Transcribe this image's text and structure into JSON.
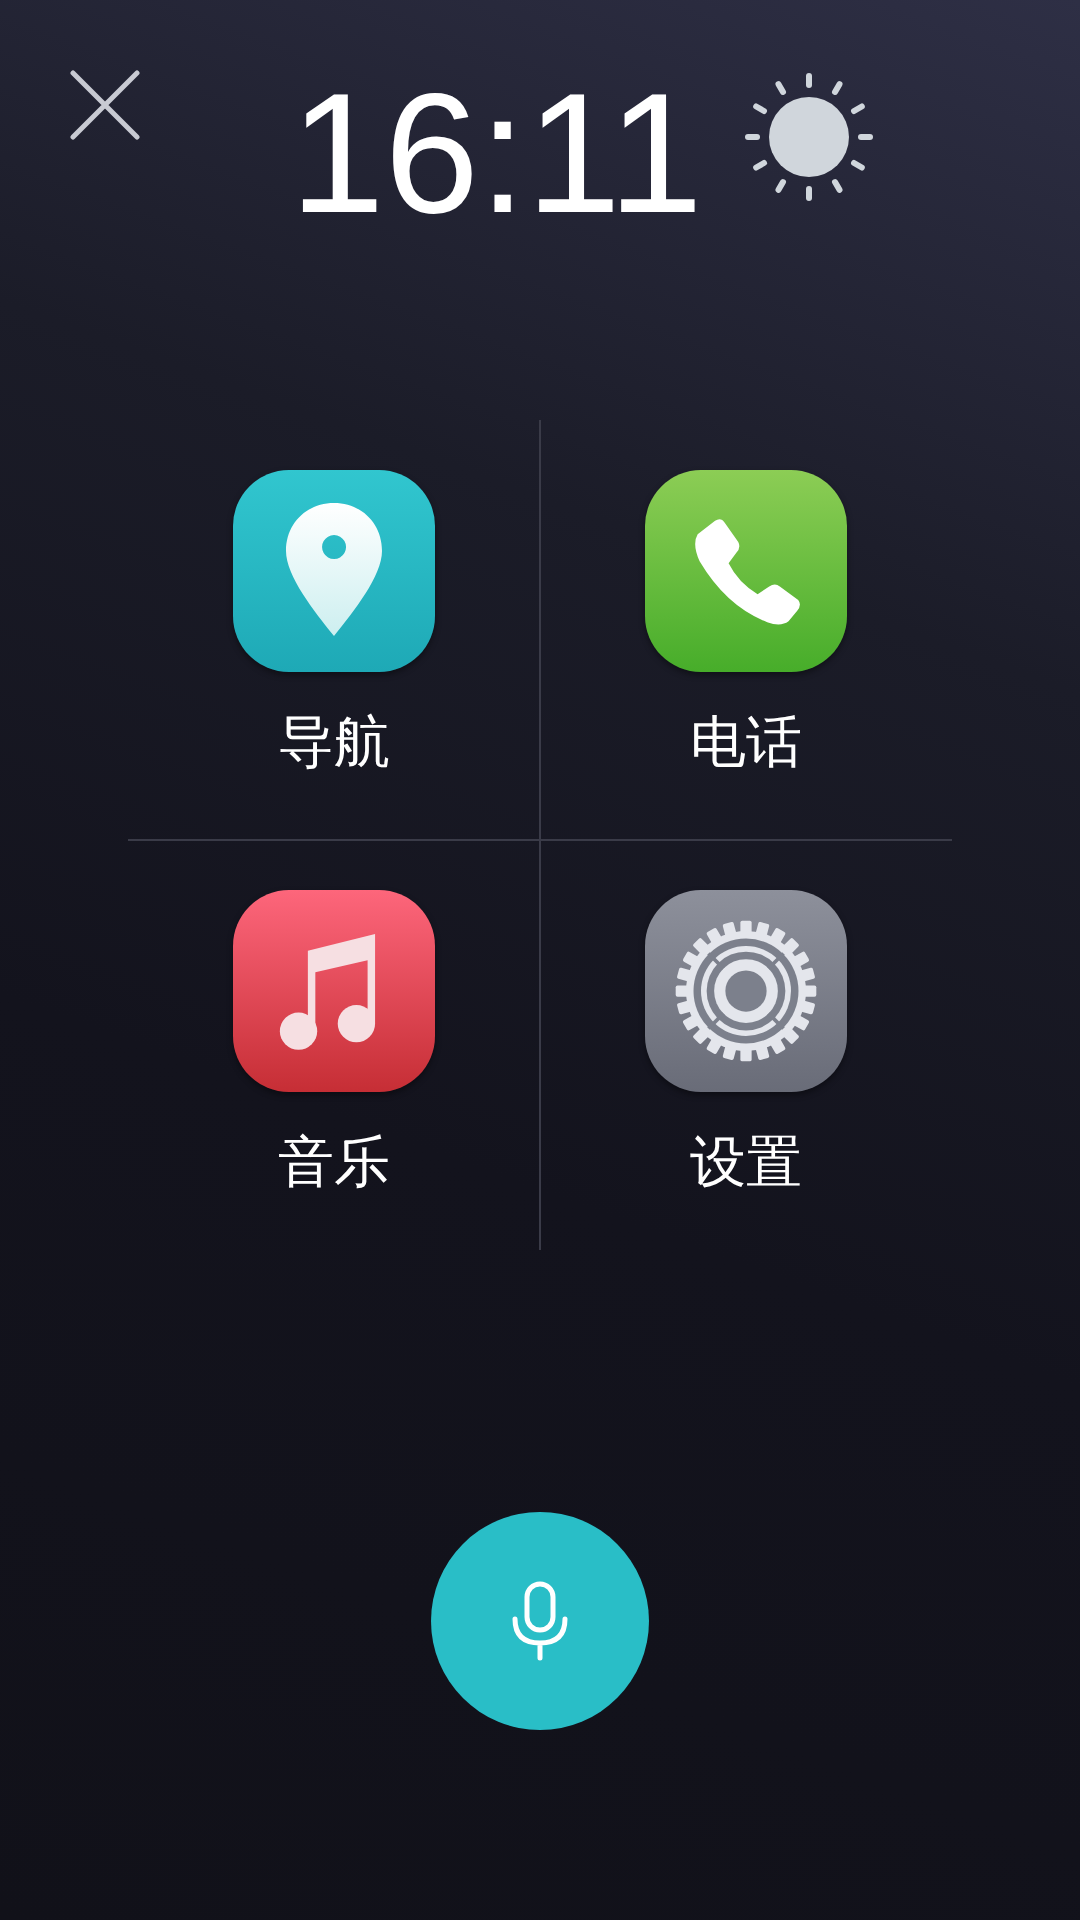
{
  "header": {
    "time": "16:11"
  },
  "apps": [
    {
      "label": "导航",
      "kind": "navigation"
    },
    {
      "label": "电话",
      "kind": "phone"
    },
    {
      "label": "音乐",
      "kind": "music"
    },
    {
      "label": "设置",
      "kind": "settings"
    }
  ]
}
